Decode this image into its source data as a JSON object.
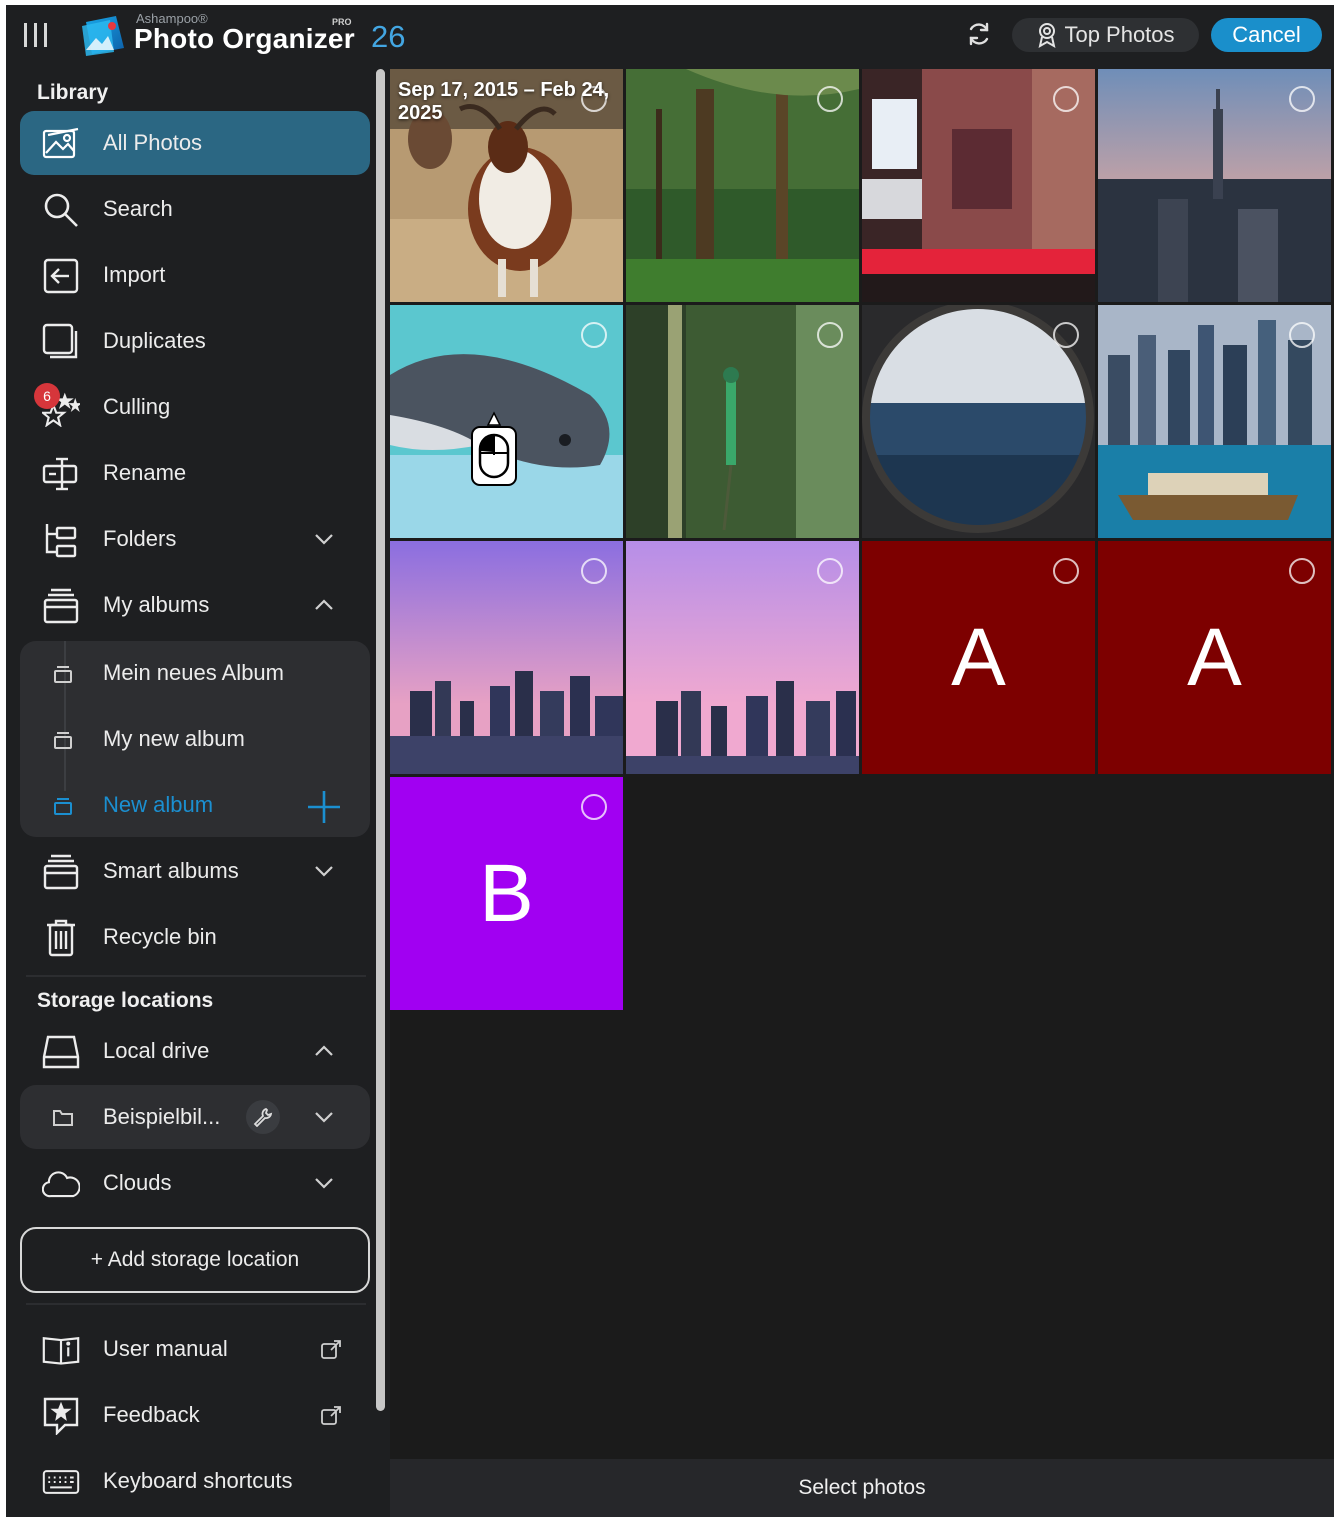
{
  "header": {
    "brand_small": "Ashampoo®",
    "brand_name": "Photo Organizer",
    "brand_pro": "PRO",
    "version": "26",
    "top_photos_label": "Top Photos",
    "cancel_label": "Cancel"
  },
  "sidebar": {
    "library_title": "Library",
    "items": [
      {
        "label": "All Photos",
        "icon": "photos-icon",
        "active": true
      },
      {
        "label": "Search",
        "icon": "search-icon"
      },
      {
        "label": "Import",
        "icon": "import-icon"
      },
      {
        "label": "Duplicates",
        "icon": "duplicates-icon"
      },
      {
        "label": "Culling",
        "icon": "culling-stars-icon",
        "badge": "6"
      },
      {
        "label": "Rename",
        "icon": "rename-icon"
      },
      {
        "label": "Folders",
        "icon": "folders-icon"
      },
      {
        "label": "My albums",
        "icon": "albums-icon"
      }
    ],
    "albums": [
      {
        "label": "Mein neues Album"
      },
      {
        "label": "My new album"
      },
      {
        "label": "New album"
      }
    ],
    "smart_albums": "Smart albums",
    "recycle_bin": "Recycle bin",
    "storage_title": "Storage locations",
    "local_drive": "Local drive",
    "folder_name": "Beispielbil...",
    "clouds": "Clouds",
    "add_storage": "+ Add storage location",
    "user_manual": "User manual",
    "feedback": "Feedback",
    "keyboard_shortcuts": "Keyboard shortcuts"
  },
  "grid": {
    "date_range": "Sep 17, 2015 – Feb 24, 2025",
    "placeholder_letters": [
      "A",
      "A",
      "B"
    ],
    "colors": {
      "red_tile": "#7d0000",
      "purple_tile": "#a100f2"
    }
  },
  "footer": {
    "status": "Select photos"
  },
  "colors": {
    "accent": "#1a8fcb",
    "active_item": "#2b6783",
    "badge": "#d6363b"
  }
}
